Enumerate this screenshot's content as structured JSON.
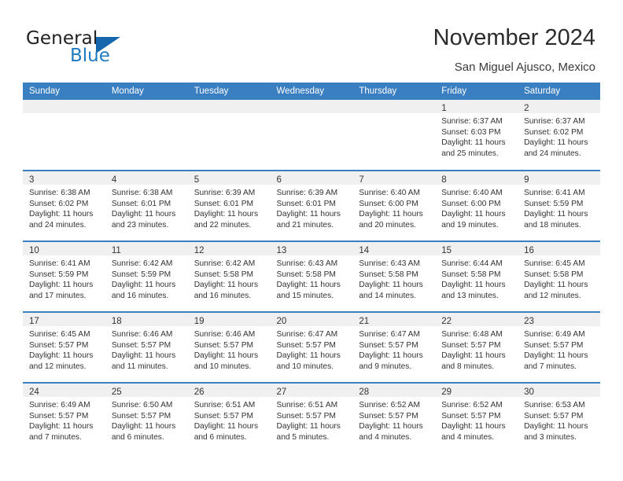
{
  "brand": {
    "word_one": "General",
    "word_two": "Blue",
    "triangle_color": "#1566ad",
    "blue_text_color": "#1f7bc1"
  },
  "header": {
    "month_title": "November 2024",
    "location": "San Miguel Ajusco, Mexico"
  },
  "theme": {
    "header_blue": "#3a7fc1",
    "daynum_band": "#f0f0f0",
    "text": "#333333"
  },
  "calendar": {
    "weekday_headers": [
      "Sunday",
      "Monday",
      "Tuesday",
      "Wednesday",
      "Thursday",
      "Friday",
      "Saturday"
    ],
    "weeks": [
      [
        {
          "day": "",
          "sunrise": "",
          "sunset": "",
          "daylight_1": "",
          "daylight_2": ""
        },
        {
          "day": "",
          "sunrise": "",
          "sunset": "",
          "daylight_1": "",
          "daylight_2": ""
        },
        {
          "day": "",
          "sunrise": "",
          "sunset": "",
          "daylight_1": "",
          "daylight_2": ""
        },
        {
          "day": "",
          "sunrise": "",
          "sunset": "",
          "daylight_1": "",
          "daylight_2": ""
        },
        {
          "day": "",
          "sunrise": "",
          "sunset": "",
          "daylight_1": "",
          "daylight_2": ""
        },
        {
          "day": "1",
          "sunrise": "Sunrise: 6:37 AM",
          "sunset": "Sunset: 6:03 PM",
          "daylight_1": "Daylight: 11 hours",
          "daylight_2": "and 25 minutes."
        },
        {
          "day": "2",
          "sunrise": "Sunrise: 6:37 AM",
          "sunset": "Sunset: 6:02 PM",
          "daylight_1": "Daylight: 11 hours",
          "daylight_2": "and 24 minutes."
        }
      ],
      [
        {
          "day": "3",
          "sunrise": "Sunrise: 6:38 AM",
          "sunset": "Sunset: 6:02 PM",
          "daylight_1": "Daylight: 11 hours",
          "daylight_2": "and 24 minutes."
        },
        {
          "day": "4",
          "sunrise": "Sunrise: 6:38 AM",
          "sunset": "Sunset: 6:01 PM",
          "daylight_1": "Daylight: 11 hours",
          "daylight_2": "and 23 minutes."
        },
        {
          "day": "5",
          "sunrise": "Sunrise: 6:39 AM",
          "sunset": "Sunset: 6:01 PM",
          "daylight_1": "Daylight: 11 hours",
          "daylight_2": "and 22 minutes."
        },
        {
          "day": "6",
          "sunrise": "Sunrise: 6:39 AM",
          "sunset": "Sunset: 6:01 PM",
          "daylight_1": "Daylight: 11 hours",
          "daylight_2": "and 21 minutes."
        },
        {
          "day": "7",
          "sunrise": "Sunrise: 6:40 AM",
          "sunset": "Sunset: 6:00 PM",
          "daylight_1": "Daylight: 11 hours",
          "daylight_2": "and 20 minutes."
        },
        {
          "day": "8",
          "sunrise": "Sunrise: 6:40 AM",
          "sunset": "Sunset: 6:00 PM",
          "daylight_1": "Daylight: 11 hours",
          "daylight_2": "and 19 minutes."
        },
        {
          "day": "9",
          "sunrise": "Sunrise: 6:41 AM",
          "sunset": "Sunset: 5:59 PM",
          "daylight_1": "Daylight: 11 hours",
          "daylight_2": "and 18 minutes."
        }
      ],
      [
        {
          "day": "10",
          "sunrise": "Sunrise: 6:41 AM",
          "sunset": "Sunset: 5:59 PM",
          "daylight_1": "Daylight: 11 hours",
          "daylight_2": "and 17 minutes."
        },
        {
          "day": "11",
          "sunrise": "Sunrise: 6:42 AM",
          "sunset": "Sunset: 5:59 PM",
          "daylight_1": "Daylight: 11 hours",
          "daylight_2": "and 16 minutes."
        },
        {
          "day": "12",
          "sunrise": "Sunrise: 6:42 AM",
          "sunset": "Sunset: 5:58 PM",
          "daylight_1": "Daylight: 11 hours",
          "daylight_2": "and 16 minutes."
        },
        {
          "day": "13",
          "sunrise": "Sunrise: 6:43 AM",
          "sunset": "Sunset: 5:58 PM",
          "daylight_1": "Daylight: 11 hours",
          "daylight_2": "and 15 minutes."
        },
        {
          "day": "14",
          "sunrise": "Sunrise: 6:43 AM",
          "sunset": "Sunset: 5:58 PM",
          "daylight_1": "Daylight: 11 hours",
          "daylight_2": "and 14 minutes."
        },
        {
          "day": "15",
          "sunrise": "Sunrise: 6:44 AM",
          "sunset": "Sunset: 5:58 PM",
          "daylight_1": "Daylight: 11 hours",
          "daylight_2": "and 13 minutes."
        },
        {
          "day": "16",
          "sunrise": "Sunrise: 6:45 AM",
          "sunset": "Sunset: 5:58 PM",
          "daylight_1": "Daylight: 11 hours",
          "daylight_2": "and 12 minutes."
        }
      ],
      [
        {
          "day": "17",
          "sunrise": "Sunrise: 6:45 AM",
          "sunset": "Sunset: 5:57 PM",
          "daylight_1": "Daylight: 11 hours",
          "daylight_2": "and 12 minutes."
        },
        {
          "day": "18",
          "sunrise": "Sunrise: 6:46 AM",
          "sunset": "Sunset: 5:57 PM",
          "daylight_1": "Daylight: 11 hours",
          "daylight_2": "and 11 minutes."
        },
        {
          "day": "19",
          "sunrise": "Sunrise: 6:46 AM",
          "sunset": "Sunset: 5:57 PM",
          "daylight_1": "Daylight: 11 hours",
          "daylight_2": "and 10 minutes."
        },
        {
          "day": "20",
          "sunrise": "Sunrise: 6:47 AM",
          "sunset": "Sunset: 5:57 PM",
          "daylight_1": "Daylight: 11 hours",
          "daylight_2": "and 10 minutes."
        },
        {
          "day": "21",
          "sunrise": "Sunrise: 6:47 AM",
          "sunset": "Sunset: 5:57 PM",
          "daylight_1": "Daylight: 11 hours",
          "daylight_2": "and 9 minutes."
        },
        {
          "day": "22",
          "sunrise": "Sunrise: 6:48 AM",
          "sunset": "Sunset: 5:57 PM",
          "daylight_1": "Daylight: 11 hours",
          "daylight_2": "and 8 minutes."
        },
        {
          "day": "23",
          "sunrise": "Sunrise: 6:49 AM",
          "sunset": "Sunset: 5:57 PM",
          "daylight_1": "Daylight: 11 hours",
          "daylight_2": "and 7 minutes."
        }
      ],
      [
        {
          "day": "24",
          "sunrise": "Sunrise: 6:49 AM",
          "sunset": "Sunset: 5:57 PM",
          "daylight_1": "Daylight: 11 hours",
          "daylight_2": "and 7 minutes."
        },
        {
          "day": "25",
          "sunrise": "Sunrise: 6:50 AM",
          "sunset": "Sunset: 5:57 PM",
          "daylight_1": "Daylight: 11 hours",
          "daylight_2": "and 6 minutes."
        },
        {
          "day": "26",
          "sunrise": "Sunrise: 6:51 AM",
          "sunset": "Sunset: 5:57 PM",
          "daylight_1": "Daylight: 11 hours",
          "daylight_2": "and 6 minutes."
        },
        {
          "day": "27",
          "sunrise": "Sunrise: 6:51 AM",
          "sunset": "Sunset: 5:57 PM",
          "daylight_1": "Daylight: 11 hours",
          "daylight_2": "and 5 minutes."
        },
        {
          "day": "28",
          "sunrise": "Sunrise: 6:52 AM",
          "sunset": "Sunset: 5:57 PM",
          "daylight_1": "Daylight: 11 hours",
          "daylight_2": "and 4 minutes."
        },
        {
          "day": "29",
          "sunrise": "Sunrise: 6:52 AM",
          "sunset": "Sunset: 5:57 PM",
          "daylight_1": "Daylight: 11 hours",
          "daylight_2": "and 4 minutes."
        },
        {
          "day": "30",
          "sunrise": "Sunrise: 6:53 AM",
          "sunset": "Sunset: 5:57 PM",
          "daylight_1": "Daylight: 11 hours",
          "daylight_2": "and 3 minutes."
        }
      ]
    ]
  }
}
